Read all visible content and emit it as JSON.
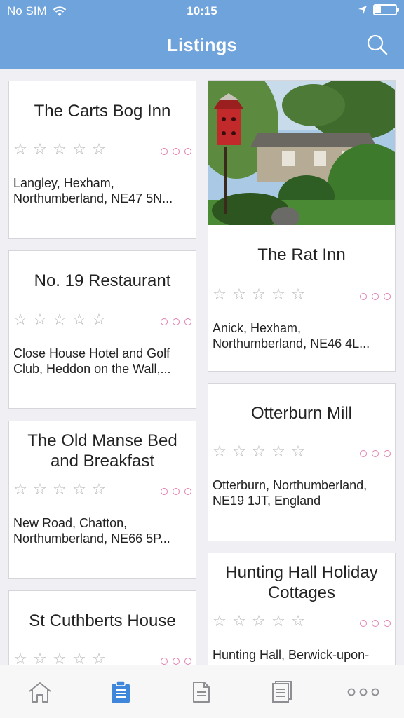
{
  "status": {
    "carrier": "No SIM",
    "time": "10:15"
  },
  "nav": {
    "title": "Listings"
  },
  "listings": [
    {
      "name_lines": [
        "The Carts Bog Inn"
      ],
      "address_lines": [
        "Langley, Hexham,",
        "Northumberland, NE47 5N..."
      ],
      "rating": 0
    },
    {
      "name_lines": [
        "The Rat Inn"
      ],
      "address_lines": [
        "Anick, Hexham,",
        "Northumberland, NE46 4L..."
      ],
      "rating": 0,
      "has_photo": true
    },
    {
      "name_lines": [
        "No. 19 Restaurant"
      ],
      "address_lines": [
        "Close House Hotel and Golf",
        "Club, Heddon on the Wall,..."
      ],
      "rating": 0
    },
    {
      "name_lines": [
        "Otterburn Mill"
      ],
      "address_lines": [
        "Otterburn, Northumberland,",
        "NE19 1JT, England"
      ],
      "rating": 0
    },
    {
      "name_lines": [
        "The Old Manse Bed",
        "and Breakfast"
      ],
      "address_lines": [
        "New Road, Chatton,",
        "Northumberland, NE66 5P..."
      ],
      "rating": 0
    },
    {
      "name_lines": [
        "Hunting Hall Holiday",
        "Cottages"
      ],
      "address_lines": [
        "Hunting Hall, Berwick-upon-"
      ],
      "rating": 0
    },
    {
      "name_lines": [
        "St Cuthberts House"
      ],
      "address_lines": [],
      "rating": 0
    }
  ],
  "tabs": [
    {
      "icon": "home-icon"
    },
    {
      "icon": "clipboard-icon",
      "active": true
    },
    {
      "icon": "document-icon"
    },
    {
      "icon": "list-document-icon"
    },
    {
      "icon": "more-icon"
    }
  ],
  "colors": {
    "accent": "#6fa3dc",
    "tab_active": "#3f87db",
    "more_dots": "#e37fb0"
  }
}
